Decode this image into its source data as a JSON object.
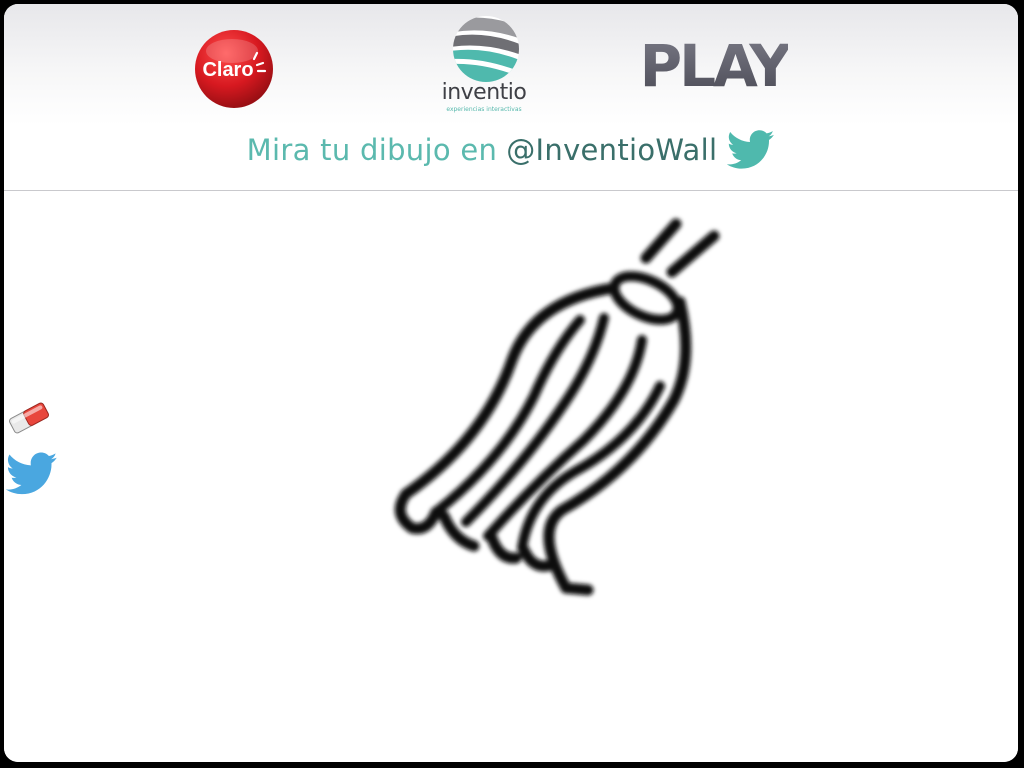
{
  "logos": {
    "claro_text": "Claro",
    "inventio_text": "inventio",
    "inventio_tagline": "experiencias interactivas",
    "play_text": "PLAY"
  },
  "tagline": {
    "prefix": "Mira tu dibujo en",
    "handle": "@InventioWall",
    "icon": "twitter-bird-icon"
  },
  "tools": [
    {
      "name": "eraser",
      "icon": "eraser-icon"
    },
    {
      "name": "tweet",
      "icon": "twitter-bird-icon"
    }
  ],
  "colors": {
    "claro_red": "#d71920",
    "inventio_teal": "#4fb9ad",
    "tagline_teal": "#5bb9ae",
    "handle_dark_teal": "#3a6f6a",
    "twitter_blue": "#4aa7e0",
    "play_gray": "#5a5a66",
    "ink": "#111111"
  }
}
